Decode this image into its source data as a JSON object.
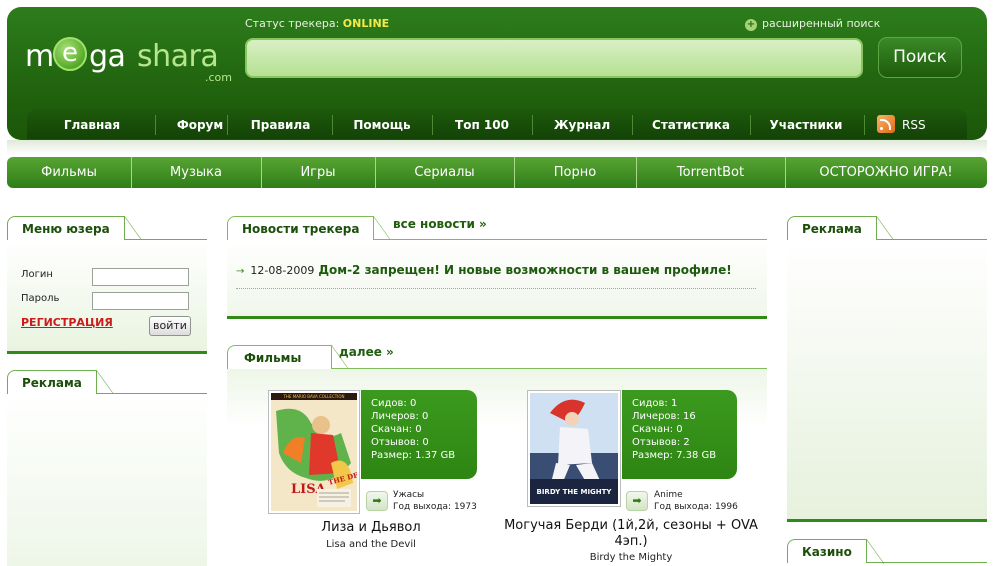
{
  "header": {
    "logo": {
      "m": "m",
      "e": "e",
      "ga": "ga",
      "shara": "shara",
      "com": ".com"
    },
    "status_label": "Статус трекера:",
    "status_value": "ONLINE",
    "advanced_search": "расширенный поиск",
    "search_placeholder": "",
    "search_button": "Поиск"
  },
  "mainnav": [
    "Главная",
    "Форум",
    "Правила",
    "Помощь",
    "Топ 100",
    "Журнал",
    "Статистика",
    "Участники",
    "RSS"
  ],
  "categories": [
    "Фильмы",
    "Музыка",
    "Игры",
    "Сериалы",
    "Порно",
    "TorrentBot",
    "ОСТОРОЖНО ИГРА!"
  ],
  "user_menu": {
    "title": "Меню юзера",
    "login_label": "Логин",
    "password_label": "Пароль",
    "register": "РЕГИСТРАЦИЯ",
    "login_button": "войти"
  },
  "left_ads": {
    "title": "Реклама"
  },
  "news": {
    "title": "Новости трекера",
    "all_link": "все новости »",
    "items": [
      {
        "date": "12-08-2009",
        "title": "Дом-2 запрещен! И новые возможности в вашем профиле!"
      }
    ]
  },
  "films": {
    "title": "Фильмы",
    "more_link": "далее »",
    "items": [
      {
        "seeds": "Сидов: 0",
        "leechers": "Личеров: 0",
        "downloaded": "Скачан: 0",
        "reviews": "Отзывов: 0",
        "size": "Размер: 1.37 GB",
        "genre": "Ужасы",
        "year": "Год выхода: 1973",
        "title": "Лиза и Дьявол",
        "original_title": "Lisa and the Devil",
        "poster_top_text": "THE MARIO BAVA COLLECTION",
        "poster_title": "LISA",
        "poster_sub": "THE DEVIL"
      },
      {
        "seeds": "Сидов: 1",
        "leechers": "Личеров: 16",
        "downloaded": "Скачан: 0",
        "reviews": "Отзывов: 2",
        "size": "Размер: 7.38 GB",
        "genre": "Anime",
        "year": "Год выхода: 1996",
        "title": "Могучая Берди (1й,2й, сезоны + OVA 4эп.)",
        "original_title": "Birdy the Mighty",
        "poster_title": "BIRDY THE MIGHTY"
      }
    ]
  },
  "right_ads": {
    "title": "Реклама"
  },
  "casino": {
    "title": "Казино"
  },
  "colors": {
    "header_green": "#22660f",
    "accent_green": "#2f8a18",
    "status_yellow": "#f4e94a",
    "link_red": "#cc1b1b"
  }
}
